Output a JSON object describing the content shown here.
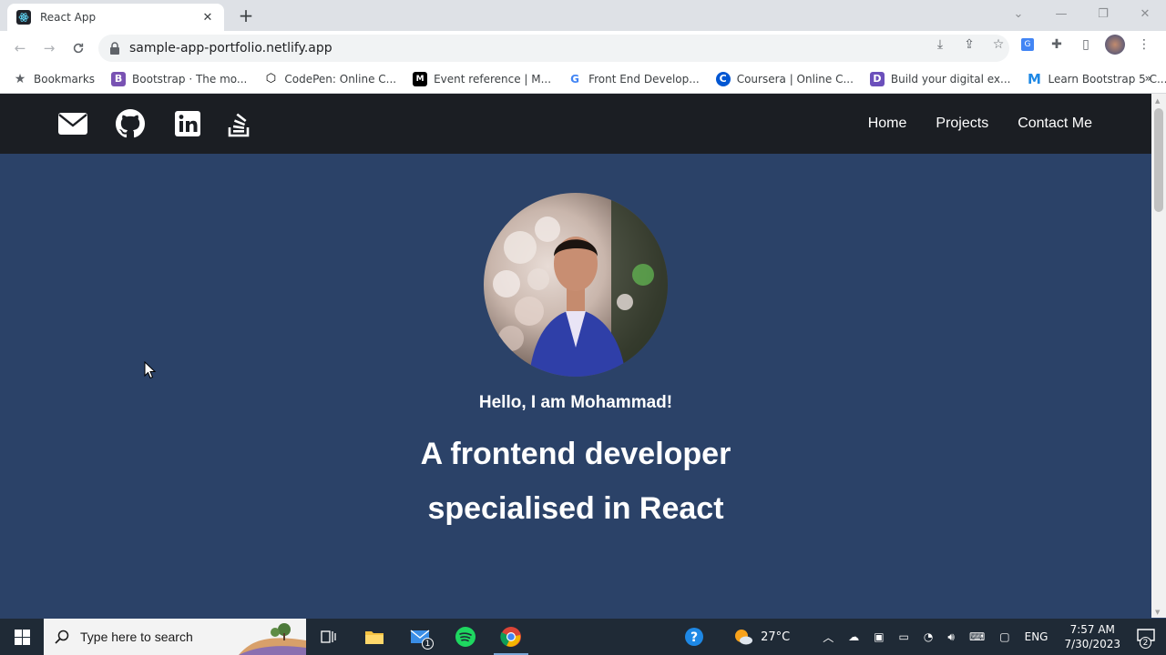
{
  "browser": {
    "tab_title": "React App",
    "url": "sample-app-portfolio.netlify.app",
    "bookmarks": [
      {
        "label": "Bookmarks",
        "icon": "star-icon",
        "color": "#5f6368"
      },
      {
        "label": "Bootstrap · The mo...",
        "icon": "B",
        "color": "#7952b3"
      },
      {
        "label": "CodePen: Online C...",
        "icon": "codepen-icon",
        "color": "#000000"
      },
      {
        "label": "Event reference | M...",
        "icon": "M",
        "color": "#000000"
      },
      {
        "label": "Front End Develop...",
        "icon": "G",
        "color": "#4285f4"
      },
      {
        "label": "Coursera | Online C...",
        "icon": "C",
        "color": "#0056d2"
      },
      {
        "label": "Build your digital ex...",
        "icon": "D",
        "color": "#6b4fbb"
      },
      {
        "label": "Learn Bootstrap 5 C...",
        "icon": "M",
        "color": "#1e88e5"
      }
    ],
    "more": "»"
  },
  "page": {
    "nav": {
      "social_icons": [
        "email-icon",
        "github-icon",
        "linkedin-icon",
        "stackoverflow-icon"
      ],
      "links": [
        "Home",
        "Projects",
        "Contact Me"
      ]
    },
    "hero": {
      "greeting": "Hello, I am Mohammad!",
      "headline_line1": "A frontend developer",
      "headline_line2": "specialised in React"
    }
  },
  "taskbar": {
    "search_placeholder": "Type here to search",
    "weather": "27°C",
    "language": "ENG",
    "time": "7:57 AM",
    "date": "7/30/2023",
    "mail_badge": "1",
    "notif_badge": "2"
  },
  "colors": {
    "page_bg": "#2b4268",
    "navbar_bg": "#1b1e23",
    "taskbar_bg": "#1f2a36"
  }
}
